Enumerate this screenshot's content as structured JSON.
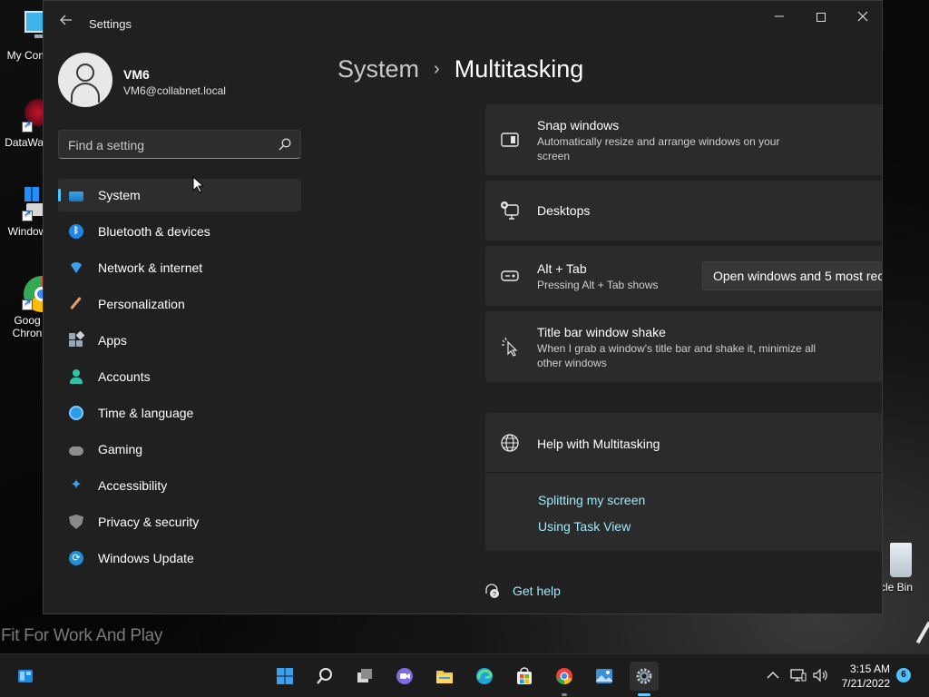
{
  "desktop": {
    "icons": [
      {
        "label": "My Com"
      },
      {
        "label": "DataWag"
      },
      {
        "label": "Window"
      },
      {
        "label": "Goog",
        "label2": "Chron"
      },
      {
        "label": "cle Bin"
      }
    ],
    "wallpaper_text": "Fit For Work And Play"
  },
  "window": {
    "title": "Settings",
    "controls": {
      "minimize": "—",
      "close": "✕"
    }
  },
  "profile": {
    "name": "VM6",
    "email": "VM6@collabnet.local"
  },
  "search": {
    "placeholder": "Find a setting"
  },
  "nav": {
    "items": [
      {
        "label": "System",
        "icon": "system-icon",
        "active": true
      },
      {
        "label": "Bluetooth & devices",
        "icon": "bluetooth-icon"
      },
      {
        "label": "Network & internet",
        "icon": "network-icon"
      },
      {
        "label": "Personalization",
        "icon": "personalization-icon"
      },
      {
        "label": "Apps",
        "icon": "apps-icon"
      },
      {
        "label": "Accounts",
        "icon": "accounts-icon"
      },
      {
        "label": "Time & language",
        "icon": "time-language-icon"
      },
      {
        "label": "Gaming",
        "icon": "gaming-icon"
      },
      {
        "label": "Accessibility",
        "icon": "accessibility-icon"
      },
      {
        "label": "Privacy & security",
        "icon": "privacy-icon"
      },
      {
        "label": "Windows Update",
        "icon": "windows-update-icon"
      }
    ]
  },
  "breadcrumb": {
    "parent": "System",
    "separator": "›",
    "current": "Multitasking"
  },
  "cards": {
    "snap": {
      "title": "Snap windows",
      "desc": "Automatically resize and arrange windows on your screen"
    },
    "desktops": {
      "title": "Desktops"
    },
    "alt_tab": {
      "title": "Alt + Tab",
      "desc": "Pressing Alt + Tab shows",
      "value": "Open windows and 5 most rec"
    },
    "shake": {
      "title": "Title bar window shake",
      "desc": "When I grab a window's title bar and shake it, minimize all other windows"
    }
  },
  "help": {
    "title": "Help with Multitasking",
    "links": [
      "Splitting my screen",
      "Using Task View"
    ],
    "get_help": "Get help"
  },
  "taskbar": {
    "apps": [
      "start-icon",
      "search-icon",
      "task-view-icon",
      "teams-chat-icon",
      "file-explorer-icon",
      "edge-icon",
      "store-icon",
      "chrome-icon",
      "photos-icon",
      "settings-icon"
    ],
    "time": "3:15 AM",
    "date": "7/21/2022",
    "notification_count": "6",
    "accent": "#60cdff"
  },
  "colors": {
    "accent": "#4cc2ff",
    "link": "#99ebff",
    "card": "#2b2b2b",
    "window": "#202020"
  }
}
